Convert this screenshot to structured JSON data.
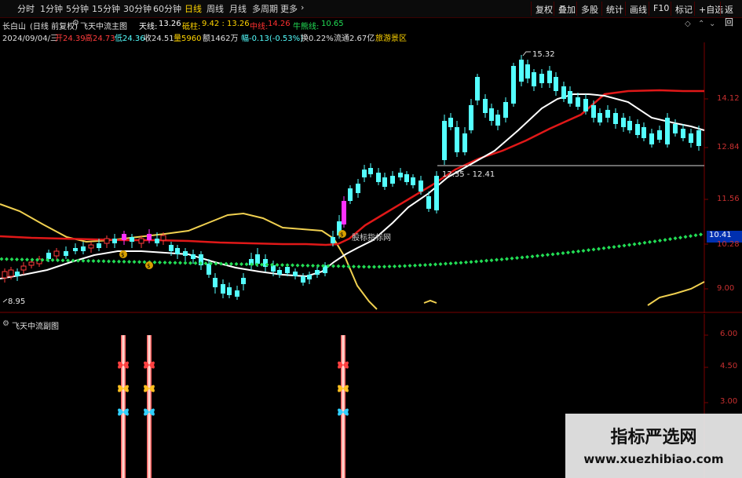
{
  "toolbar": {
    "timeframes": [
      "分时",
      "1分钟",
      "5分钟",
      "15分钟",
      "30分钟",
      "60分钟",
      "日线",
      "周线",
      "月线",
      "多周期",
      "更多"
    ],
    "active_timeframe": "日线",
    "buttons": [
      "复权",
      "叠加",
      "多股",
      "统计",
      "画线",
      "F10",
      "标记",
      "+自选",
      "返回"
    ]
  },
  "stock": {
    "name": "长白山",
    "mode": "(日线 前复权)"
  },
  "main_indicator": {
    "name": "飞天中流主图",
    "tianxian_label": "天线:",
    "tianxian_value": "13.26",
    "dizhu_label": "砥柱:",
    "dizhu_values": "9.42 : 13.26",
    "zhongxian_label": "中线:",
    "zhongxian_value": "14.26",
    "niuxiong_label": "牛熊线:",
    "niuxiong_value": "10.65"
  },
  "quote": {
    "date": "2024/09/04/三",
    "open": "开24.39",
    "high": "高24.73",
    "low": "低24.36",
    "close": "收24.51",
    "volume": "量5960",
    "amount": "额1462万",
    "change": "幅-0.13(-0.53%)",
    "turnover": "换0.22%",
    "float_cap": "流通2.67亿",
    "sector": "旅游景区"
  },
  "annotations": {
    "high_mark": "15.32",
    "low_mark": "8.95",
    "range_label": "12.35 - 12.41",
    "watermark_mid": "股标指标网",
    "price_tag": "10.41"
  },
  "price_axis": [
    "14.12",
    "12.84",
    "11.56",
    "10.28",
    "9.00"
  ],
  "sub_indicator": {
    "name": "飞天中流副图"
  },
  "sub_axis": [
    "6.00",
    "4.50",
    "3.00"
  ],
  "watermark": {
    "title": "指标严选网",
    "url": "www.xuezhibiao.com"
  },
  "colors": {
    "up": "#ff3c3c",
    "down": "#54ffff",
    "ma_white": "#ffffff",
    "ma_red": "#e01818",
    "yellow": "#f0d050",
    "dots": "#22dd55",
    "signal": "#ff7070"
  }
}
